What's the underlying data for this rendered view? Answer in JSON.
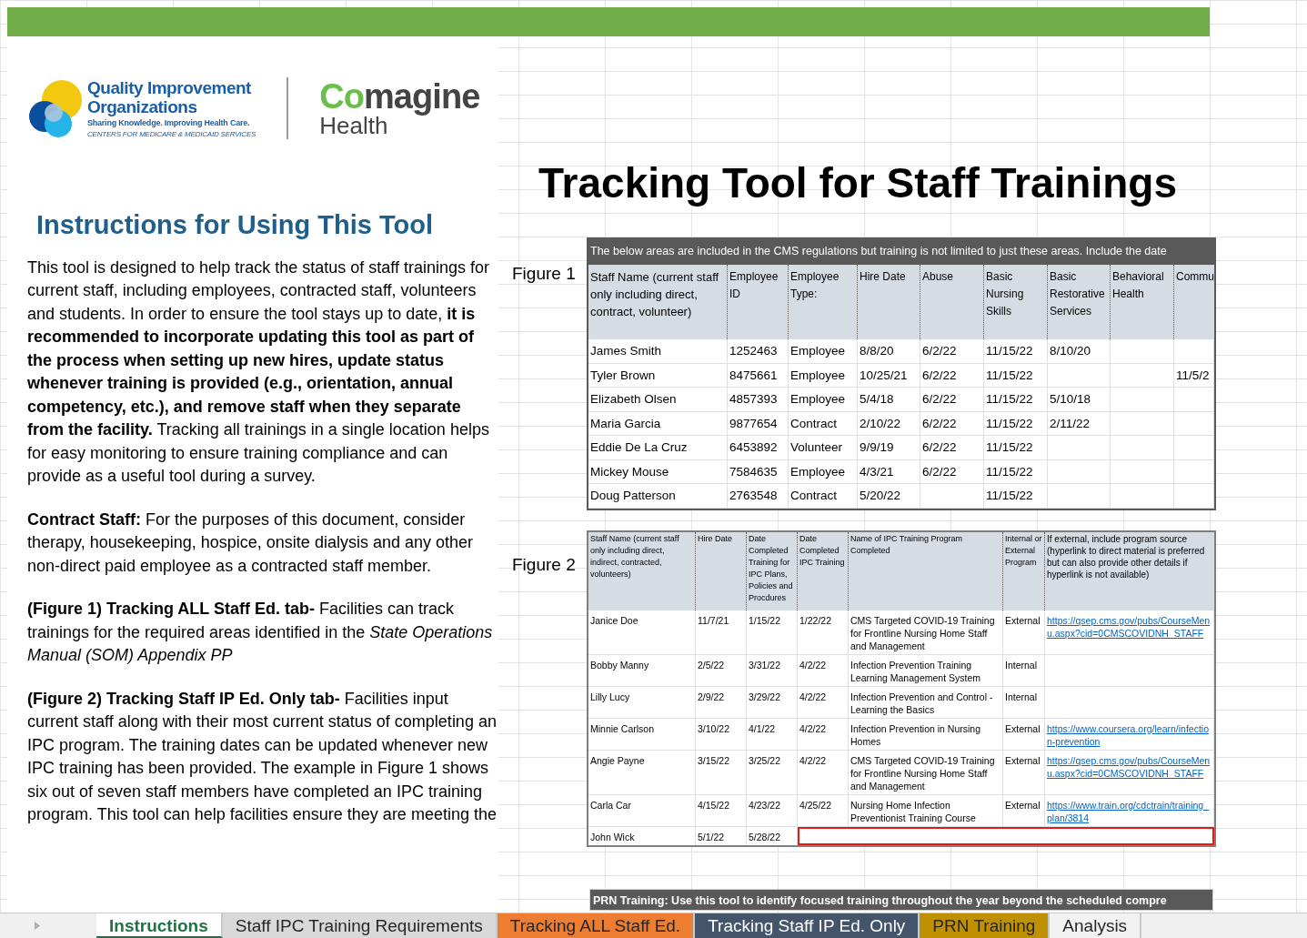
{
  "logos": {
    "qio": {
      "name_line_1": "Quality Improvement",
      "name_line_2": "Organizations",
      "tagline": "Sharing Knowledge. Improving Health Care.",
      "agency": "CENTERS FOR MEDICARE & MEDICAID SERVICES"
    },
    "comagine": {
      "brand_prefix": "Co",
      "brand_rest": "magine",
      "subtitle": "Health"
    }
  },
  "title": "Tracking Tool for Staff Trainings",
  "instructions": {
    "heading": "Instructions for Using This Tool",
    "paragraphs": [
      "This tool is designed to help track the status of staff trainings for current staff, including employees, contracted staff, volunteers and students. In order to ensure the tool stays up to date, **it is recommended to incorporate updating this tool as part of the process when setting up new hires, update status whenever training is provided (e.g., orientation, annual competency, etc.), and remove staff when they separate from the facility.** Tracking all trainings in a single location helps for easy monitoring to ensure training compliance and can provide as a useful tool during a survey.",
      "**Contract Staff:** For the purposes of this document, consider therapy, housekeeping, hospice, onsite dialysis and any other non-direct paid employee as a contracted staff member.",
      "**(Figure 1) Tracking ALL Staff Ed. tab-** Facilities can track trainings for the required areas identified in the *State Operations Manual (SOM) Appendix PP*",
      "**(Figure 2) Tracking Staff IP Ed. Only tab-** Facilities input current staff along with their most current status of completing an IPC program. The training dates can be updated whenever new IPC training has been provided. The example in Figure 1 shows six out of seven staff members have completed an IPC training program. This tool can help facilities ensure they are meeting the"
    ]
  },
  "figure_1": {
    "label": "Figure 1",
    "banner": "The below areas are included in the CMS regulations but training is not limited to just these areas. Include the date",
    "columns": [
      "Staff Name (current staff only including direct, contract, volunteer)",
      "Employee ID",
      "Employee Type:",
      "Hire Date",
      "Abuse",
      "Basic Nursing Skills",
      "Basic Restorative Services",
      "Behavioral Health",
      "Commu"
    ],
    "rows": [
      [
        "James Smith",
        "1252463",
        "Employee",
        "8/8/20",
        "6/2/22",
        "11/15/22",
        "8/10/20",
        null,
        null
      ],
      [
        "Tyler Brown",
        "8475661",
        "Employee",
        "10/25/21",
        "6/2/22",
        "11/15/22",
        null,
        null,
        "11/5/2"
      ],
      [
        "Elizabeth Olsen",
        "4857393",
        "Employee",
        "5/4/18",
        "6/2/22",
        "11/15/22",
        "5/10/18",
        null,
        null
      ],
      [
        "Maria Garcia",
        "9877654",
        "Contract",
        "2/10/22",
        "6/2/22",
        "11/15/22",
        "2/11/22",
        null,
        null
      ],
      [
        "Eddie De La Cruz",
        "6453892",
        "Volunteer",
        "9/9/19",
        "6/2/22",
        "11/15/22",
        null,
        null,
        null
      ],
      [
        "Mickey Mouse",
        "7584635",
        "Employee",
        "4/3/21",
        "6/2/22",
        "11/15/22",
        null,
        null,
        null
      ],
      [
        "Doug Patterson",
        "2763548",
        "Contract",
        "5/20/22",
        null,
        "11/15/22",
        null,
        null,
        null
      ]
    ]
  },
  "figure_2": {
    "label": "Figure 2",
    "columns": [
      {
        "label": "Staff Name (current staff only including direct, indirect, contracted, volunteers)",
        "kind": "text"
      },
      {
        "label": "Hire Date",
        "kind": "text"
      },
      {
        "label": "Date Completed Training for IPC Plans, Policies and Procdures",
        "kind": "text"
      },
      {
        "label": "Date Completed IPC Training",
        "kind": "text"
      },
      {
        "label": "Name of IPC Training Program Completed",
        "kind": "text"
      },
      {
        "label": "Internal or External Program",
        "kind": "text"
      },
      {
        "label": "If external, include program source (hyperlink to direct material is preferred but can also provide other details if hyperlink is not available)",
        "kind": "link"
      }
    ],
    "rows": [
      {
        "cells": [
          "Janice Doe",
          "11/7/21",
          "1/15/22",
          "1/22/22",
          "CMS Targeted COVID-19 Training for Frontline Nursing Home Staff and Management",
          "External",
          "https://qsep.cms.gov/pubs/CourseMenu.aspx?cid=0CMSCOVIDNH_STAFF"
        ],
        "flagged": false
      },
      {
        "cells": [
          "Bobby Manny",
          "2/5/22",
          "3/31/22",
          "4/2/22",
          "Infection Prevention Training Learning Management System",
          "Internal",
          null
        ],
        "flagged": false
      },
      {
        "cells": [
          "Lilly Lucy",
          "2/9/22",
          "3/29/22",
          "4/2/22",
          "Infection Prevention and Control - Learning the Basics",
          "Internal",
          null
        ],
        "flagged": false
      },
      {
        "cells": [
          "Minnie Carlson",
          "3/10/22",
          "4/1/22",
          "4/2/22",
          "Infection Prevention in Nursing Homes",
          "External",
          "https://www.coursera.org/learn/infection-prevention"
        ],
        "flagged": false
      },
      {
        "cells": [
          "Angie Payne",
          "3/15/22",
          "3/25/22",
          "4/2/22",
          "CMS Targeted COVID-19 Training for Frontline Nursing Home Staff and Management",
          "External",
          "https://qsep.cms.gov/pubs/CourseMenu.aspx?cid=0CMSCOVIDNH_STAFF"
        ],
        "flagged": false
      },
      {
        "cells": [
          "Carla Car",
          "4/15/22",
          "4/23/22",
          "4/25/22",
          "Nursing Home Infection Preventionist Training Course",
          "External",
          "https://www.train.org/cdctrain/training_plan/3814"
        ],
        "flagged": false
      },
      {
        "cells": [
          "John Wick",
          "5/1/22",
          "5/28/22",
          null,
          null,
          null,
          null
        ],
        "flagged": true
      }
    ]
  },
  "prn_banner": "PRN Training: Use this tool to identify focused training throughout the year beyond the scheduled compre",
  "sheet_tabs": [
    {
      "label": "Instructions",
      "selected": true,
      "color": "#ffffff"
    },
    {
      "label": "Staff IPC Training Requirements",
      "selected": false,
      "color": "#d9d9d9"
    },
    {
      "label": "Tracking ALL Staff Ed.",
      "selected": false,
      "color": "#ed7d31"
    },
    {
      "label": "Tracking Staff IP Ed. Only",
      "selected": false,
      "color": "#44546a"
    },
    {
      "label": "PRN Training",
      "selected": false,
      "color": "#bf9000"
    },
    {
      "label": "Analysis",
      "selected": false,
      "color": "#f2f2f2"
    }
  ]
}
